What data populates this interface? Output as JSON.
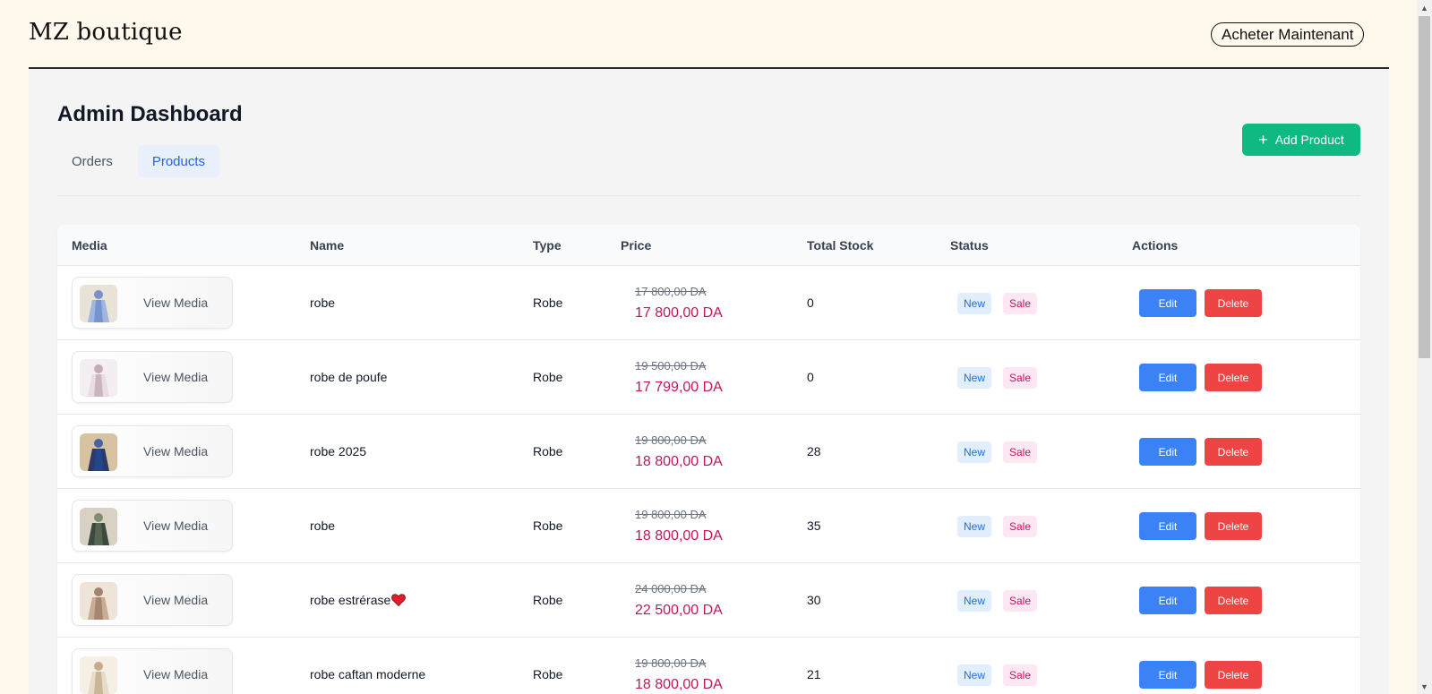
{
  "header": {
    "brand": "MZ boutique",
    "cta_label": "Acheter Maintenant"
  },
  "dashboard": {
    "title": "Admin Dashboard",
    "tabs": [
      {
        "label": "Orders",
        "active": false
      },
      {
        "label": "Products",
        "active": true
      }
    ],
    "add_product_label": "Add Product"
  },
  "table": {
    "columns": [
      "Media",
      "Name",
      "Type",
      "Price",
      "Total Stock",
      "Status",
      "Actions"
    ],
    "rows": [
      {
        "media_label": "View Media",
        "name": "robe",
        "type": "Robe",
        "old_price": "17 800,00 DA",
        "price": "17 800,00 DA",
        "stock": "0",
        "status": [
          "New",
          "Sale"
        ],
        "heart": false
      },
      {
        "media_label": "View Media",
        "name": "robe de poufe",
        "type": "Robe",
        "old_price": "19 500,00 DA",
        "price": "17 799,00 DA",
        "stock": "0",
        "status": [
          "New",
          "Sale"
        ],
        "heart": false
      },
      {
        "media_label": "View Media",
        "name": "robe 2025",
        "type": "Robe",
        "old_price": "19 800,00 DA",
        "price": "18 800,00 DA",
        "stock": "28",
        "status": [
          "New",
          "Sale"
        ],
        "heart": false
      },
      {
        "media_label": "View Media",
        "name": "robe",
        "type": "Robe",
        "old_price": "19 800,00 DA",
        "price": "18 800,00 DA",
        "stock": "35",
        "status": [
          "New",
          "Sale"
        ],
        "heart": false
      },
      {
        "media_label": "View Media",
        "name": "robe estrérase",
        "type": "Robe",
        "old_price": "24 000,00 DA",
        "price": "22 500,00 DA",
        "stock": "30",
        "status": [
          "New",
          "Sale"
        ],
        "heart": true
      },
      {
        "media_label": "View Media",
        "name": "robe caftan moderne",
        "type": "Robe",
        "old_price": "19 800,00 DA",
        "price": "18 800,00 DA",
        "stock": "21",
        "status": [
          "New",
          "Sale"
        ],
        "heart": false
      }
    ],
    "edit_label": "Edit",
    "delete_label": "Delete"
  },
  "colors": {
    "page_bg": "#fff8ec",
    "panel_bg": "#f4f4f5",
    "accent_green": "#10b981",
    "edit_blue": "#3b82f6",
    "delete_red": "#ef4444",
    "price_pink": "#be185d"
  },
  "icons": {
    "add": "plus-icon",
    "name_emoji": "heart-icon"
  }
}
